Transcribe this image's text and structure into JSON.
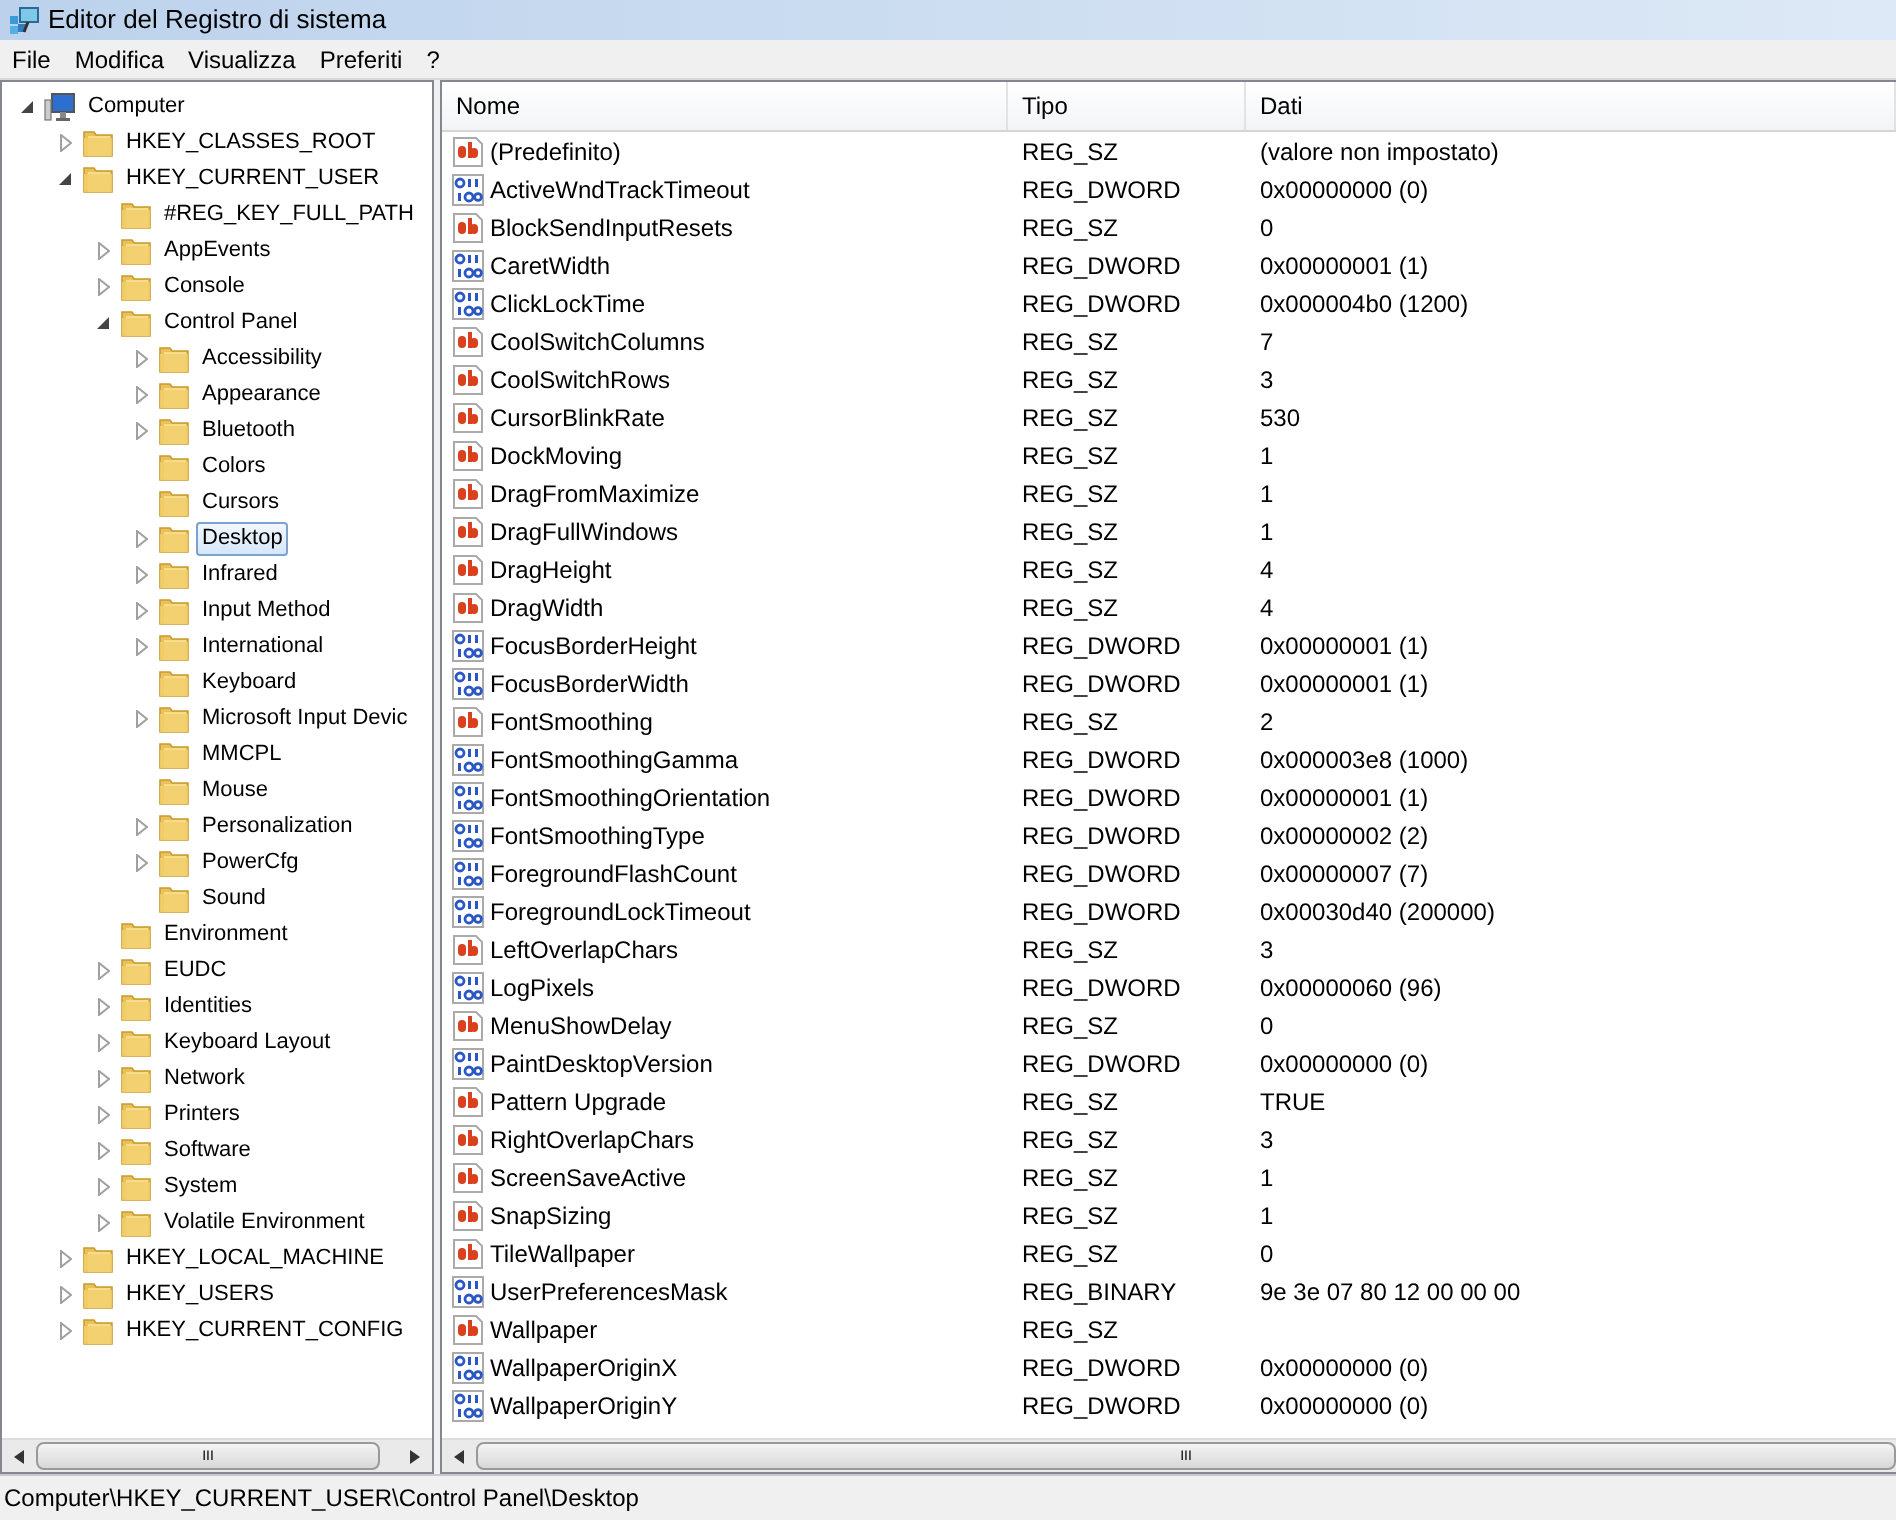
{
  "window": {
    "title": "Editor del Registro di sistema"
  },
  "menu": [
    "File",
    "Modifica",
    "Visualizza",
    "Preferiti",
    "?"
  ],
  "tree": [
    {
      "label": "Computer",
      "kind": "computer",
      "expanded": true,
      "selected": false,
      "children": [
        {
          "label": "HKEY_CLASSES_ROOT",
          "expanded": false,
          "selected": false
        },
        {
          "label": "HKEY_CURRENT_USER",
          "expanded": true,
          "selected": false,
          "children": [
            {
              "label": "#REG_KEY_FULL_PATH",
              "selected": false
            },
            {
              "label": "AppEvents",
              "expanded": false,
              "selected": false
            },
            {
              "label": "Console",
              "expanded": false,
              "selected": false
            },
            {
              "label": "Control Panel",
              "expanded": true,
              "selected": false,
              "children": [
                {
                  "label": "Accessibility",
                  "expanded": false,
                  "selected": false
                },
                {
                  "label": "Appearance",
                  "expanded": false,
                  "selected": false
                },
                {
                  "label": "Bluetooth",
                  "expanded": false,
                  "selected": false
                },
                {
                  "label": "Colors",
                  "selected": false
                },
                {
                  "label": "Cursors",
                  "selected": false
                },
                {
                  "label": "Desktop",
                  "expanded": false,
                  "selected": true
                },
                {
                  "label": "Infrared",
                  "expanded": false,
                  "selected": false
                },
                {
                  "label": "Input Method",
                  "expanded": false,
                  "selected": false
                },
                {
                  "label": "International",
                  "expanded": false,
                  "selected": false
                },
                {
                  "label": "Keyboard",
                  "selected": false
                },
                {
                  "label": "Microsoft Input Devic",
                  "expanded": false,
                  "selected": false
                },
                {
                  "label": "MMCPL",
                  "selected": false
                },
                {
                  "label": "Mouse",
                  "selected": false
                },
                {
                  "label": "Personalization",
                  "expanded": false,
                  "selected": false
                },
                {
                  "label": "PowerCfg",
                  "expanded": false,
                  "selected": false
                },
                {
                  "label": "Sound",
                  "selected": false
                }
              ]
            },
            {
              "label": "Environment",
              "selected": false
            },
            {
              "label": "EUDC",
              "expanded": false,
              "selected": false
            },
            {
              "label": "Identities",
              "expanded": false,
              "selected": false
            },
            {
              "label": "Keyboard Layout",
              "expanded": false,
              "selected": false
            },
            {
              "label": "Network",
              "expanded": false,
              "selected": false
            },
            {
              "label": "Printers",
              "expanded": false,
              "selected": false
            },
            {
              "label": "Software",
              "expanded": false,
              "selected": false
            },
            {
              "label": "System",
              "expanded": false,
              "selected": false
            },
            {
              "label": "Volatile Environment",
              "expanded": false,
              "selected": false
            }
          ]
        },
        {
          "label": "HKEY_LOCAL_MACHINE",
          "expanded": false,
          "selected": false
        },
        {
          "label": "HKEY_USERS",
          "expanded": false,
          "selected": false
        },
        {
          "label": "HKEY_CURRENT_CONFIG",
          "expanded": false,
          "selected": false
        }
      ]
    }
  ],
  "table": {
    "columns": [
      "Nome",
      "Tipo",
      "Dati"
    ],
    "rows": [
      {
        "kind": "string",
        "name": "(Predefinito)",
        "type": "REG_SZ",
        "data": "(valore non impostato)"
      },
      {
        "kind": "binary",
        "name": "ActiveWndTrackTimeout",
        "type": "REG_DWORD",
        "data": "0x00000000 (0)"
      },
      {
        "kind": "string",
        "name": "BlockSendInputResets",
        "type": "REG_SZ",
        "data": "0"
      },
      {
        "kind": "binary",
        "name": "CaretWidth",
        "type": "REG_DWORD",
        "data": "0x00000001 (1)"
      },
      {
        "kind": "binary",
        "name": "ClickLockTime",
        "type": "REG_DWORD",
        "data": "0x000004b0 (1200)"
      },
      {
        "kind": "string",
        "name": "CoolSwitchColumns",
        "type": "REG_SZ",
        "data": "7"
      },
      {
        "kind": "string",
        "name": "CoolSwitchRows",
        "type": "REG_SZ",
        "data": "3"
      },
      {
        "kind": "string",
        "name": "CursorBlinkRate",
        "type": "REG_SZ",
        "data": "530"
      },
      {
        "kind": "string",
        "name": "DockMoving",
        "type": "REG_SZ",
        "data": "1"
      },
      {
        "kind": "string",
        "name": "DragFromMaximize",
        "type": "REG_SZ",
        "data": "1"
      },
      {
        "kind": "string",
        "name": "DragFullWindows",
        "type": "REG_SZ",
        "data": "1"
      },
      {
        "kind": "string",
        "name": "DragHeight",
        "type": "REG_SZ",
        "data": "4"
      },
      {
        "kind": "string",
        "name": "DragWidth",
        "type": "REG_SZ",
        "data": "4"
      },
      {
        "kind": "binary",
        "name": "FocusBorderHeight",
        "type": "REG_DWORD",
        "data": "0x00000001 (1)"
      },
      {
        "kind": "binary",
        "name": "FocusBorderWidth",
        "type": "REG_DWORD",
        "data": "0x00000001 (1)"
      },
      {
        "kind": "string",
        "name": "FontSmoothing",
        "type": "REG_SZ",
        "data": "2"
      },
      {
        "kind": "binary",
        "name": "FontSmoothingGamma",
        "type": "REG_DWORD",
        "data": "0x000003e8 (1000)"
      },
      {
        "kind": "binary",
        "name": "FontSmoothingOrientation",
        "type": "REG_DWORD",
        "data": "0x00000001 (1)"
      },
      {
        "kind": "binary",
        "name": "FontSmoothingType",
        "type": "REG_DWORD",
        "data": "0x00000002 (2)"
      },
      {
        "kind": "binary",
        "name": "ForegroundFlashCount",
        "type": "REG_DWORD",
        "data": "0x00000007 (7)"
      },
      {
        "kind": "binary",
        "name": "ForegroundLockTimeout",
        "type": "REG_DWORD",
        "data": "0x00030d40 (200000)"
      },
      {
        "kind": "string",
        "name": "LeftOverlapChars",
        "type": "REG_SZ",
        "data": "3"
      },
      {
        "kind": "binary",
        "name": "LogPixels",
        "type": "REG_DWORD",
        "data": "0x00000060 (96)"
      },
      {
        "kind": "string",
        "name": "MenuShowDelay",
        "type": "REG_SZ",
        "data": "0"
      },
      {
        "kind": "binary",
        "name": "PaintDesktopVersion",
        "type": "REG_DWORD",
        "data": "0x00000000 (0)"
      },
      {
        "kind": "string",
        "name": "Pattern Upgrade",
        "type": "REG_SZ",
        "data": "TRUE"
      },
      {
        "kind": "string",
        "name": "RightOverlapChars",
        "type": "REG_SZ",
        "data": "3"
      },
      {
        "kind": "string",
        "name": "ScreenSaveActive",
        "type": "REG_SZ",
        "data": "1"
      },
      {
        "kind": "string",
        "name": "SnapSizing",
        "type": "REG_SZ",
        "data": "1"
      },
      {
        "kind": "string",
        "name": "TileWallpaper",
        "type": "REG_SZ",
        "data": "0"
      },
      {
        "kind": "binary",
        "name": "UserPreferencesMask",
        "type": "REG_BINARY",
        "data": "9e 3e 07 80 12 00 00 00"
      },
      {
        "kind": "string",
        "name": "Wallpaper",
        "type": "REG_SZ"
      },
      {
        "kind": "binary",
        "name": "WallpaperOriginX",
        "type": "REG_DWORD",
        "data": "0x00000000 (0)"
      },
      {
        "kind": "binary",
        "name": "WallpaperOriginY",
        "type": "REG_DWORD",
        "data": "0x00000000 (0)"
      }
    ]
  },
  "scrollbars": {
    "left_grip": "III",
    "right_grip": "III"
  },
  "status_bar": "Computer\\HKEY_CURRENT_USER\\Control Panel\\Desktop"
}
